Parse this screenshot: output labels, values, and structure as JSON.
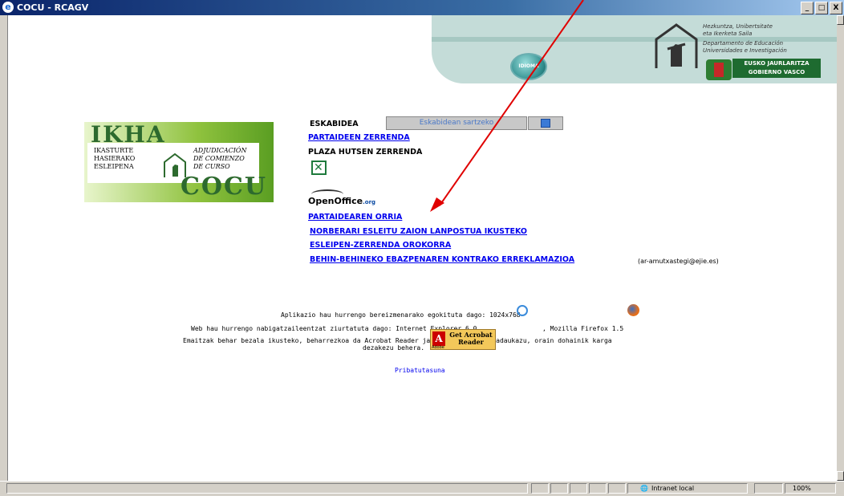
{
  "window": {
    "title": "COCU - RCAGV",
    "app_icon": "e",
    "controls": {
      "minimize": "_",
      "maximize": "□",
      "close": "X"
    }
  },
  "header": {
    "idioma_label": "IDIOMA",
    "department_lines": [
      "Hezkuntza, Unibertsitate",
      "eta Ikerketa Saila",
      "Departamento de Educación",
      "Universidades e Investigación"
    ],
    "gov_badge_lines": [
      "EUSKO JAURLARITZA",
      "GOBIERNO VASCO"
    ]
  },
  "logo": {
    "title_top": "IKHA",
    "title_bottom": "COCU",
    "basque_lines": [
      "IKASTURTE",
      "HASIERAKO",
      "ESLEIPENA"
    ],
    "spanish_lines": [
      "ADJUDICACIÓN",
      "DE COMIENZO",
      "DE CURSO"
    ]
  },
  "menu": {
    "eskabidea_label": "ESKABIDEA",
    "eskabidea_input_text": "Eskabidean sartzeko",
    "partaideen_zerrenda": "PARTAIDEEN ZERRENDA",
    "plaza_hutsen_zerrenda": "PLAZA HUTSEN ZERRENDA",
    "openoffice_brand": "OpenOffice",
    "openoffice_suffix": ".org",
    "partaidearen_orria": "PARTAIDEAREN ORRIA",
    "norberari": "NORBERARI ESLEITU ZAION LANPOSTUA IKUSTEKO",
    "esleipen_zerrenda": "ESLEIPEN-ZERRENDA OROKORRA",
    "behin_behineko": "BEHIN-BEHINEKO EBAZPENAREN KONTRAKO ERREKLAMAZIOA",
    "email": "(ar-amutxastegi@ejie.es)"
  },
  "footer": {
    "resolution_text": "Aplikazio hau hurrengo bereizmenarako egokituta dago: 1024x768",
    "browsers_text": "Web hau hurrengo nabigatzaileentzat ziurtatuta dago:  Internet Explorer 6.0",
    "firefox_text": ",  Mozilla Firefox 1.5",
    "acrobat_line1": "Emaitzak behar bezala ikusteko, beharrezkoa da Acrobat Reader jarrita izatea.Ez badaukazu, orain dohainik karga",
    "acrobat_line2": "dezakezu behera.",
    "acrobat_badge_line1": "Get Acrobat",
    "acrobat_badge_line2": "Reader",
    "acrobat_badge_adobe": "Adobe",
    "privacy_link": "Pribatutasuna"
  },
  "statusbar": {
    "zone": "Intranet local",
    "zoom": "100%"
  },
  "colors": {
    "link": "#0000ee",
    "annotation_arrow": "#e00000",
    "titlebar": "#0a246a"
  }
}
